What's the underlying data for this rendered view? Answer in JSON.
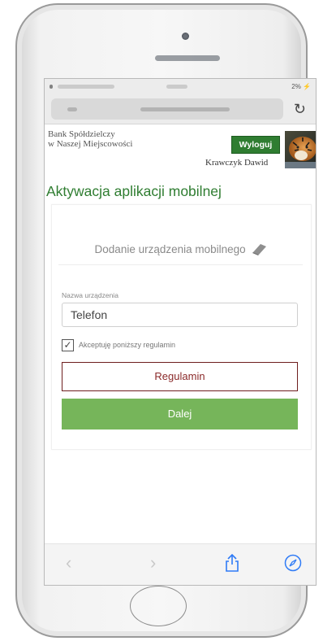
{
  "status_bar": {
    "battery_text": "2% ⚡"
  },
  "url_bar": {
    "reload_icon": "↻"
  },
  "bank": {
    "name_line1": "Bank Spółdzielczy",
    "name_line2": "w Naszej Miejscowości",
    "logout_label": "Wyloguj",
    "user_name": "Krawczyk Dawid"
  },
  "page": {
    "title": "Aktywacja aplikacji mobilnej",
    "section_title": "Dodanie urządzenia mobilnego",
    "device_name_label": "Nazwa urządzenia",
    "device_name_value": "Telefon",
    "accept_label": "Akceptuję poniższy regulamin",
    "rules_button": "Regulamin",
    "next_button": "Dalej"
  },
  "toolbar": {
    "back_icon": "‹",
    "forward_icon": "›"
  },
  "colors": {
    "brand_green": "#2f7d31",
    "button_green": "#76b55a",
    "rules_border": "#6e1e1e"
  }
}
